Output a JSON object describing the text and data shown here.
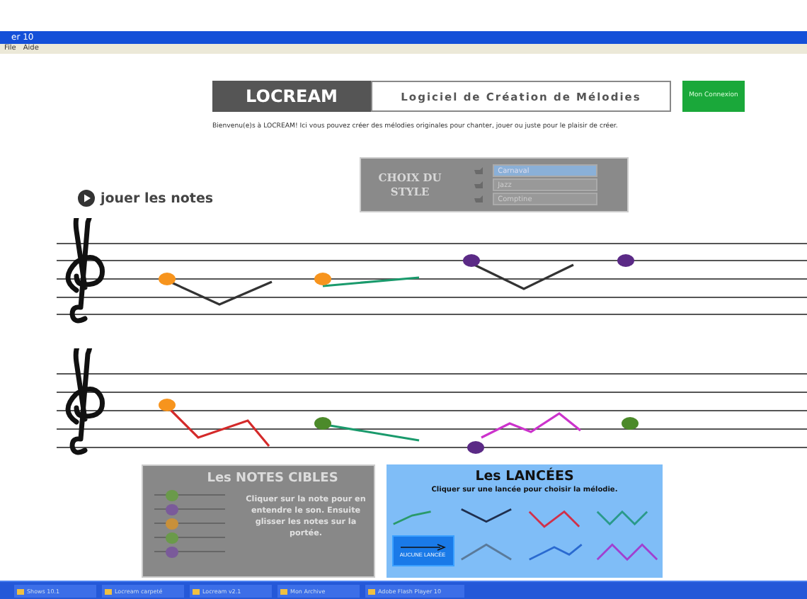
{
  "window": {
    "title": "er 10"
  },
  "menu": [
    "File",
    "Aide"
  ],
  "header": {
    "logo": "LOCREAM",
    "subtitle": "Logiciel de Création de Mélodies",
    "account_button": "Mon Connexion"
  },
  "welcome": "Bienvenu(e)s à LOCREAM! Ici vous pouvez créer des mélodies originales pour chanter, jouer ou juste pour le plaisir de créer.",
  "play_label": "jouer les notes",
  "style_panel": {
    "title": "CHOIX DU STYLE",
    "options": [
      {
        "label": "Carnaval",
        "selected": true
      },
      {
        "label": "Jazz",
        "selected": false
      },
      {
        "label": "Comptine",
        "selected": false
      }
    ]
  },
  "staves": [
    {
      "notes": [
        {
          "color": "#f7941d"
        },
        {
          "color": "#f7941d"
        },
        {
          "color": "#5b2a86"
        },
        {
          "color": "#5b2a86"
        }
      ],
      "lines": [
        {
          "color": "#333333"
        },
        {
          "color": "#1a9a6c"
        },
        {
          "color": "#333333"
        }
      ]
    },
    {
      "notes": [
        {
          "color": "#f7941d"
        },
        {
          "color": "#4c8a2a"
        },
        {
          "color": "#5b2a86"
        },
        {
          "color": "#4c8a2a"
        }
      ],
      "lines": [
        {
          "color": "#d42a2a"
        },
        {
          "color": "#1a9a6c"
        },
        {
          "color": "#cc33cc"
        }
      ]
    }
  ],
  "notes_cibles": {
    "title": "Les NOTES CIBLES",
    "text": "Cliquer sur la note pour en entendre le son. Ensuite glisser les notes sur la portée.",
    "notes": [
      {
        "color": "#6a9a4a"
      },
      {
        "color": "#7a5a9a"
      },
      {
        "color": "#c8903a"
      },
      {
        "color": "#6a9a4a"
      },
      {
        "color": "#7a5a9a"
      }
    ]
  },
  "lancees": {
    "title": "Les LANCÉES",
    "subtitle": "Cliquer sur une lancée pour choisir la mélodie.",
    "items": [
      {
        "kind": "line",
        "color": "#2a9a6a"
      },
      {
        "kind": "line",
        "color": "#1f2f4f"
      },
      {
        "kind": "line",
        "color": "#d0304a"
      },
      {
        "kind": "line",
        "color": "#2a9a8a"
      },
      {
        "kind": "none",
        "label": "AUCUNE LANCÉE"
      },
      {
        "kind": "line",
        "color": "#5a7a9a"
      },
      {
        "kind": "line",
        "color": "#2a6ad0"
      },
      {
        "kind": "line",
        "color": "#a040d0"
      }
    ]
  },
  "taskbar": [
    "Shows 10.1",
    "Locream carpeté",
    "Locream v2.1",
    "Mon Archive",
    "Adobe Flash Player 10"
  ]
}
